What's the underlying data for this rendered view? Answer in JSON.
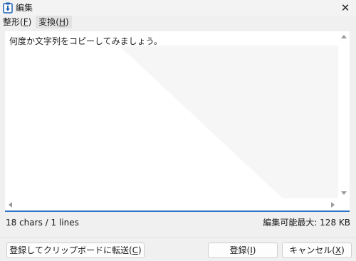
{
  "window": {
    "title": "編集",
    "close_glyph": "✕"
  },
  "menu": {
    "items": [
      {
        "label": "整形(",
        "mnemonic": "F",
        "suffix": ")"
      },
      {
        "label": "変換(",
        "mnemonic": "H",
        "suffix": ")"
      }
    ]
  },
  "editor": {
    "text": "何度か文字列をコピーしてみましょう。"
  },
  "status": {
    "counts": "18 chars / 1 lines",
    "capacity": "編集可能最大: 128 KB"
  },
  "buttons": {
    "register_copy": {
      "label": "登録してクリップボードに転送(",
      "mnemonic": "C",
      "suffix": ")"
    },
    "register": {
      "label": "登録(",
      "mnemonic": "I",
      "suffix": ")"
    },
    "cancel": {
      "label": "キャンセル(",
      "mnemonic": "X",
      "suffix": ")"
    }
  },
  "colors": {
    "accent": "#2b74c6",
    "icon_blue": "#1e5fb4"
  },
  "icons": {
    "app": "clipboard-arrow-icon",
    "close": "close-icon",
    "scroll_up": "arrow-up-icon",
    "scroll_down": "arrow-down-icon",
    "scroll_left": "arrow-left-icon",
    "scroll_right": "arrow-right-icon"
  }
}
